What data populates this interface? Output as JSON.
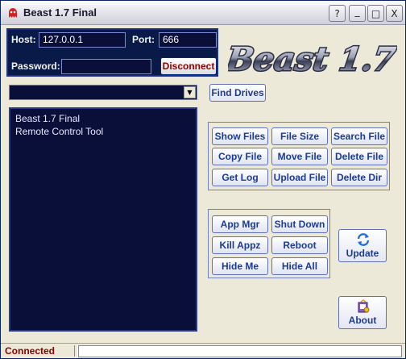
{
  "window": {
    "title": "Beast 1.7 Final",
    "controls": {
      "help": "?",
      "minimize": "_",
      "maximize": "□",
      "close": "X"
    }
  },
  "connection": {
    "host_label": "Host:",
    "host_value": "127.0.0.1",
    "port_label": "Port:",
    "port_value": "666",
    "password_label": "Password:",
    "password_value": "",
    "disconnect_label": "Disconnect"
  },
  "logo": {
    "text": "Beast 1.7"
  },
  "drives": {
    "selected": "",
    "find_label": "Find Drives"
  },
  "output": {
    "lines": [
      "Beast 1.7 Final",
      "Remote Control Tool"
    ]
  },
  "file_buttons": {
    "show_files": "Show Files",
    "file_size": "File Size",
    "search_file": "Search File",
    "copy_file": "Copy File",
    "move_file": "Move File",
    "delete_file": "Delete File",
    "get_log": "Get Log",
    "upload_file": "Upload File",
    "delete_dir": "Delete Dir"
  },
  "system_buttons": {
    "app_mgr": "App Mgr",
    "shut_down": "Shut Down",
    "kill_appz": "Kill Appz",
    "reboot": "Reboot",
    "hide_me": "Hide Me",
    "hide_all": "Hide All"
  },
  "side_buttons": {
    "update": "Update",
    "about": "About"
  },
  "status": {
    "text": "Connected",
    "detail": ""
  },
  "colors": {
    "window_bg": "#ece9d8",
    "dark_panel": "#0a0f3a",
    "button_text": "#1e3b94",
    "status_red": "#8b0000"
  }
}
